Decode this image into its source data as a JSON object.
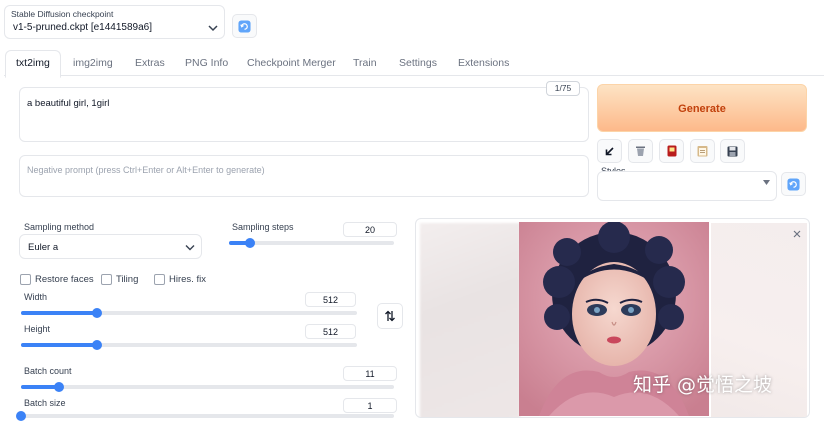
{
  "checkpoint": {
    "label": "Stable Diffusion checkpoint",
    "value": "v1-5-pruned.ckpt [e1441589a6]"
  },
  "tabs": [
    "txt2img",
    "img2img",
    "Extras",
    "PNG Info",
    "Checkpoint Merger",
    "Train",
    "Settings",
    "Extensions"
  ],
  "prompt": {
    "value": "a beautiful girl, 1girl",
    "token_counter": "1/75"
  },
  "negative_prompt": {
    "placeholder": "Negative prompt (press Ctrl+Enter or Alt+Enter to generate)"
  },
  "generate": {
    "label": "Generate"
  },
  "styles": {
    "label": "Styles",
    "value": ""
  },
  "sampling_method": {
    "label": "Sampling method",
    "value": "Euler a"
  },
  "sampling_steps": {
    "label": "Sampling steps",
    "value": 20,
    "min": 1,
    "max": 150
  },
  "checkboxes": {
    "restore_faces": "Restore faces",
    "tiling": "Tiling",
    "hires_fix": "Hires. fix"
  },
  "width": {
    "label": "Width",
    "value": 512,
    "min": 64,
    "max": 2048
  },
  "height": {
    "label": "Height",
    "value": 512,
    "min": 64,
    "max": 2048
  },
  "batch_count": {
    "label": "Batch count",
    "value": 11,
    "min": 1,
    "max": 100
  },
  "batch_size": {
    "label": "Batch size",
    "value": 1,
    "min": 1,
    "max": 8
  },
  "watermark": "知乎 @觉悟之坡",
  "colors": {
    "accent": "#3b82f6",
    "generate_from": "#fde3c4",
    "generate_to": "#fdb98a",
    "generate_text": "#c2410c"
  },
  "icons": {
    "refresh": "refresh-icon",
    "arrow": "arrow-down-left-icon",
    "trash": "trash-icon",
    "card": "red-card-icon",
    "paste": "clipboard-icon",
    "save": "save-icon",
    "swap": "swap-icon",
    "close": "close-icon",
    "chevron": "chevron-down-icon"
  }
}
